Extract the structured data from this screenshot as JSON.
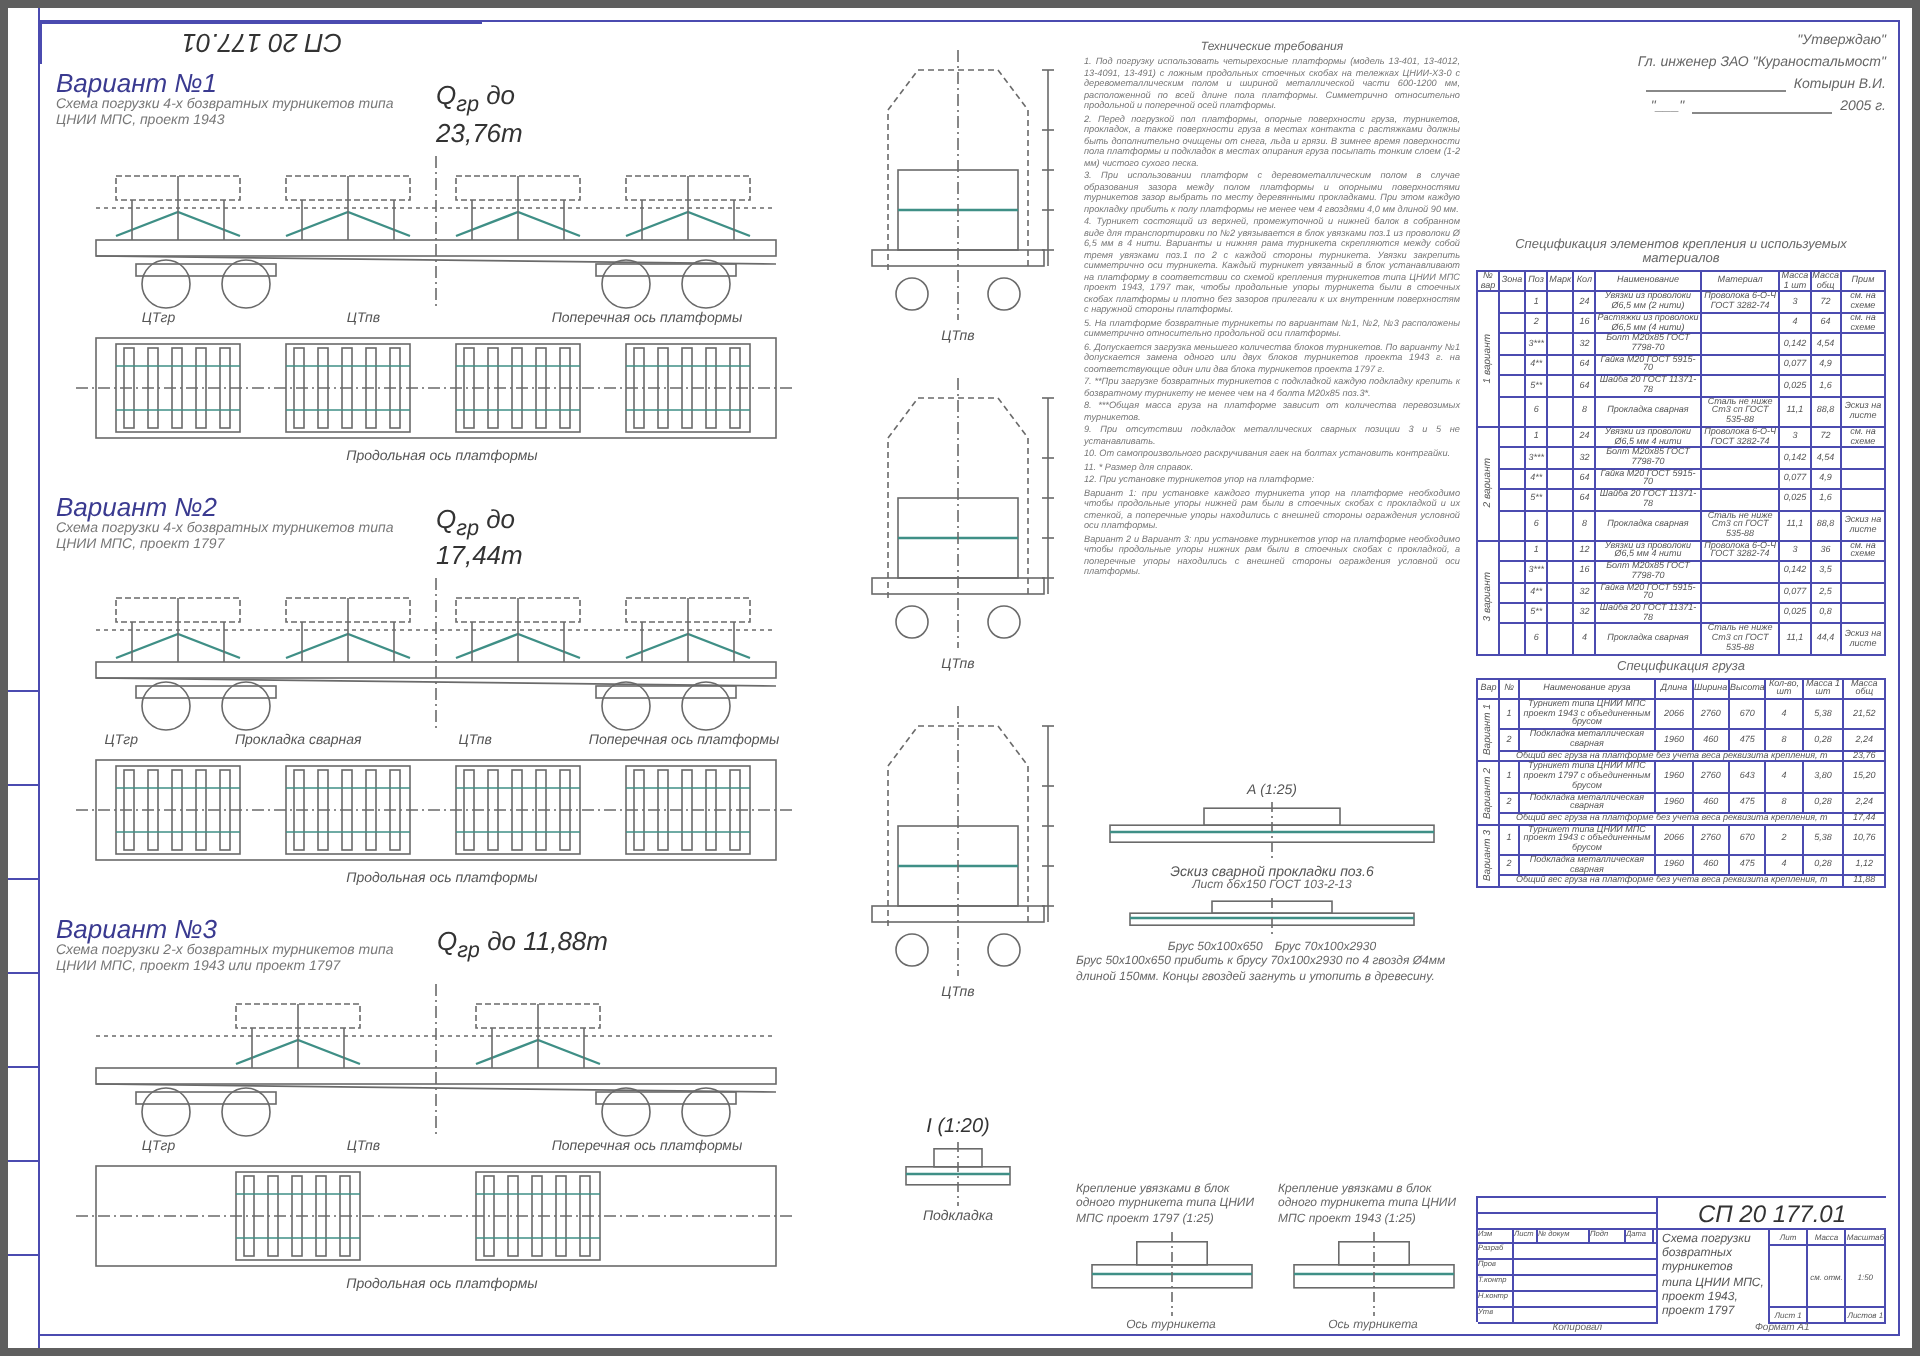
{
  "stamp": "СП 20 177.01",
  "variants": [
    {
      "kind": "four_units",
      "title": "Вариант №1",
      "subtitle": "Схема погрузки 4-х бозвратных турникетов типа ЦНИИ МПС, проект 1943",
      "load": "Q$_{гр}$ до 23,76т",
      "side_labels": [
        "ЦТгр",
        "ЦТпв",
        "Поперечная ось платформы"
      ],
      "top_label": "Продольная ось платформы"
    },
    {
      "kind": "four_units",
      "title": "Вариант №2",
      "subtitle": "Схема погрузки 4-х бозвратных турникетов типа ЦНИИ МПС, проект 1797",
      "load": "Q$_{гр}$ до 17,44т",
      "side_labels": [
        "ЦТгр",
        "Прокладка сварная",
        "ЦТпв",
        "Поперечная ось платформы"
      ],
      "top_label": "Продольная ось платформы"
    },
    {
      "kind": "two_units",
      "title": "Вариант №3",
      "subtitle": "Схема погрузки 2-х бозвратных турникетов типа ЦНИИ МПС, проект 1943 или проект 1797",
      "load": "Q$_{гр}$ до 11,88т",
      "side_labels": [
        "ЦТгр",
        "ЦТпв",
        "Поперечная ось платформы"
      ],
      "top_label": "Продольная ось платформы"
    }
  ],
  "sections": [
    {
      "label": "ЦТпв"
    },
    {
      "label": "ЦТпв"
    },
    {
      "label": "ЦТпв"
    }
  ],
  "detail_i": {
    "title": "I (1:20)",
    "label": "Подкладка"
  },
  "notes": {
    "title": "Технические требования",
    "items": [
      "1. Под погрузку использовать четырехосные платформы (модель 13-401, 13-4012, 13-4091, 13-491) с ложным продольных стоечных скобах на тележках ЦНИИ-Х3-0 с деревометаллическим полом и шириной металлической части 600-1200 мм, расположенной по всей длине пола платформы. Симметрично относительно продольной и поперечной осей платформы.",
      "2. Перед погрузкой пол платформы, опорные поверхности груза, турникетов, прокладок, а также поверхности груза в местах контакта с растяжками должны быть дополнительно очищены от снега, льда и грязи. В зимнее время поверхности пола платформы и подкладок в местах опирания груза посыпать тонким слоем (1-2 мм) чистого сухого песка.",
      "3. При использовании платформ с деревометаллическим полом в случае образования зазора между полом платформы и опорными поверхностями турникетов зазор выбрать по месту деревянными прокладками. При этом каждую прокладку прибить к полу платформы не менее чем 4 гвоздями 4,0 мм длиной 90 мм.",
      "4. Турникет состоящий из верхней, промежуточной и нижней балок в собранном виде для транспортировки по №2 увязывается в блок увязками поз.1 из проволоки Ø 6,5 мм в 4 нити. Варианты и нижняя рама турникета скрепляются между собой тремя увязками поз.1 по 2 с каждой стороны турникета. Увязки закрепить симметрично оси турникета. Каждый турникет увязанный в блок устанавливают на платформу в соответствии со схемой крепления турникетов типа ЦНИИ МПС проект 1943, 1797 так, чтобы продольные упоры турникета были в стоечных скобах платформы и плотно без зазоров прилегали к их внутренним поверхностям с наружной стороны платформы.",
      "5. На платформе бозвратные турникеты по вариантам №1, №2, №3 расположены симметрично относительно продольной оси платформы.",
      "6. Допускается загрузка меньшего количества блоков турникетов. По варианту №1 допускается замена одного или двух блоков турникетов проекта 1943 г. на соответствующие один или два блока турникетов проекта 1797 г.",
      "7. **При загрузке бозвратных турникетов с подкладкой каждую подкладку крепить к бозвратному турникету не менее чем на 4 болта М20х85 поз.3*.",
      "8. ***Общая масса груза на платформе зависит от количества перевозимых турникетов.",
      "9. При отсутствии подкладок металлических сварных позиции 3 и 5 не устанавливать.",
      "10. От самопроизвольного раскручивания гаек на болтах установить контргайки.",
      "11. * Размер для справок.",
      "12. При установке турникетов упор на платформе:",
      "Вариант 1: при установке каждого турникета упор на платформе необходимо чтобы продольные упоры нижней рам были в стоечных скобах с прокладкой и их стенкой, а поперечные упоры находились с внешней стороны ограждения условной оси платформы.",
      "Вариант 2 и Вариант 3: при установке турникетов упор на платформе необходимо чтобы продольные упоры нижних рам были в стоечных скобах с прокладкой, а поперечные упоры находились с внешней стороны ограждения условной оси платформы."
    ]
  },
  "approval": {
    "head": "\"Утверждаю\"",
    "position": "Гл. инженер ЗАО \"Кураностальмост\"",
    "name": "Котырин В.И.",
    "date_mark": "\"___\"",
    "year": "2005 г."
  },
  "section_a": {
    "title": "А (1:25)"
  },
  "weld_pad": {
    "title": "Эскиз сварной прокладки поз.6",
    "spec": "Лист δ6х150 ГОСТ 103-2-13",
    "bar_small": "Брус 50х100х650",
    "bar_large": "Брус 70х100х2930",
    "note": "Брус 50х100х650 прибить к брусу 70х100х2930 по 4 гвоздя Ø4мм длиной 150мм. Концы гвоздей загнуть и утопить в древесину."
  },
  "fastening": [
    {
      "title": "Крепление увязками в блок одного турникета типа ЦНИИ МПС проект 1797 (1:25)",
      "label": "Ось турникета"
    },
    {
      "title": "Крепление увязками в блок одного турникета типа ЦНИИ МПС проект 1943 (1:25)",
      "label": "Ось турникета"
    }
  ],
  "spec_table": {
    "title": "Спецификация элементов крепления и используемых материалов",
    "columns": [
      "№ вар",
      "Зона",
      "Поз",
      "Марк",
      "Кол",
      "Наименование",
      "Материал",
      "Масса 1 шт",
      "Масса общ",
      "Прим"
    ],
    "groups": [
      {
        "variant": "1 вариант",
        "rows": [
          [
            "",
            "1",
            "",
            "24",
            "Увязки из проволоки Ø6,5 мм (2 нити)",
            "Проволока 6-О-Ч ГОСТ 3282-74",
            "3",
            "72",
            "см. на схеме"
          ],
          [
            "",
            "2",
            "",
            "16",
            "Растяжки из проволоки Ø6,5 мм (4 нити)",
            "",
            "4",
            "64",
            "см. на схеме"
          ],
          [
            "",
            "3***",
            "",
            "32",
            "Болт М20х85 ГОСТ 7798-70",
            "",
            "0,142",
            "4,54",
            ""
          ],
          [
            "",
            "4**",
            "",
            "64",
            "Гайка М20 ГОСТ 5915-70",
            "",
            "0,077",
            "4,9",
            ""
          ],
          [
            "",
            "5**",
            "",
            "64",
            "Шайба 20 ГОСТ 11371-78",
            "",
            "0,025",
            "1,6",
            ""
          ],
          [
            "",
            "6",
            "",
            "8",
            "Прокладка сварная",
            "Сталь не ниже Ст3 сп ГОСТ 535-88",
            "11,1",
            "88,8",
            "Эскиз на листе"
          ]
        ]
      },
      {
        "variant": "2 вариант",
        "rows": [
          [
            "",
            "1",
            "",
            "24",
            "Увязки из проволоки Ø6,5 мм 4 нити",
            "Проволока 6-О-Ч ГОСТ 3282-74",
            "3",
            "72",
            "см. на схеме"
          ],
          [
            "",
            "3***",
            "",
            "32",
            "Болт М20х85 ГОСТ 7798-70",
            "",
            "0,142",
            "4,54",
            ""
          ],
          [
            "",
            "4**",
            "",
            "64",
            "Гайка М20 ГОСТ 5915-70",
            "",
            "0,077",
            "4,9",
            ""
          ],
          [
            "",
            "5**",
            "",
            "64",
            "Шайба 20 ГОСТ 11371-78",
            "",
            "0,025",
            "1,6",
            ""
          ],
          [
            "",
            "6",
            "",
            "8",
            "Прокладка сварная",
            "Сталь не ниже Ст3 сп ГОСТ 535-88",
            "11,1",
            "88,8",
            "Эскиз на листе"
          ]
        ]
      },
      {
        "variant": "3 вариант",
        "rows": [
          [
            "",
            "1",
            "",
            "12",
            "Увязки из проволоки Ø6,5 мм 4 нити",
            "Проволока 6-О-Ч ГОСТ 3282-74",
            "3",
            "36",
            "см. на схеме"
          ],
          [
            "",
            "3***",
            "",
            "16",
            "Болт М20х85 ГОСТ 7798-70",
            "",
            "0,142",
            "3,5",
            ""
          ],
          [
            "",
            "4**",
            "",
            "32",
            "Гайка М20 ГОСТ 5915-70",
            "",
            "0,077",
            "2,5",
            ""
          ],
          [
            "",
            "5**",
            "",
            "32",
            "Шайба 20 ГОСТ 11371-78",
            "",
            "0,025",
            "0,8",
            ""
          ],
          [
            "",
            "6",
            "",
            "4",
            "Прокладка сварная",
            "Сталь не ниже Ст3 сп ГОСТ 535-88",
            "11,1",
            "44,4",
            "Эскиз на листе"
          ]
        ]
      }
    ]
  },
  "cargo_table": {
    "title": "Спецификация груза",
    "columns": [
      "Вар",
      "№",
      "Наименование груза",
      "Длина",
      "Ширина",
      "Высота",
      "Кол-во, шт",
      "Масса 1 шт",
      "Масса общ"
    ],
    "groups": [
      {
        "variant": "Вариант 1",
        "rows": [
          [
            "1",
            "Турникет типа ЦНИИ МПС проект 1943 с объединенным брусом",
            "2066",
            "2760",
            "670",
            "4",
            "5,38",
            "21,52"
          ],
          [
            "2",
            "Подкладка металлическая сварная",
            "1960",
            "460",
            "475",
            "8",
            "0,28",
            "2,24"
          ]
        ],
        "total_label": "Общий вес груза на платформе без учета веса реквизита крепления, т",
        "total": "23,76"
      },
      {
        "variant": "Вариант 2",
        "rows": [
          [
            "1",
            "Турникет типа ЦНИИ МПС проект 1797 с объединенным брусом",
            "1960",
            "2760",
            "643",
            "4",
            "3,80",
            "15,20"
          ],
          [
            "2",
            "Подкладка металлическая сварная",
            "1960",
            "460",
            "475",
            "8",
            "0,28",
            "2,24"
          ]
        ],
        "total_label": "Общий вес груза на платформе без учета веса реквизита крепления, т",
        "total": "17,44"
      },
      {
        "variant": "Вариант 3",
        "rows": [
          [
            "1",
            "Турникет типа ЦНИИ МПС проект 1943 с объединенным брусом",
            "2066",
            "2760",
            "670",
            "2",
            "5,38",
            "10,76"
          ],
          [
            "2",
            "Подкладка металлическая сварная",
            "1960",
            "460",
            "475",
            "4",
            "0,28",
            "1,12"
          ]
        ],
        "total_label": "Общий вес груза на платформе без учета веса реквизита крепления, т",
        "total": "11,88"
      }
    ]
  },
  "title_block": {
    "code": "СП 20 177.01",
    "name": "Схема погрузки бозвратных турникетов типа ЦНИИ МПС, проект 1943, проект 1797",
    "cols": [
      "Изм",
      "Лист",
      "№ докум",
      "Подп",
      "Дата"
    ],
    "roles": [
      "Разраб",
      "Пров",
      "Т.контр",
      "Н.контр",
      "Утв"
    ],
    "lit": "Лит",
    "mass": "Масса",
    "scale": "Масштаб",
    "mass_value": "см. отм.",
    "scale_value": "1:50",
    "sheet": "Лист 1",
    "sheets": "Листов 1"
  },
  "footer": {
    "copied": "Копировал",
    "format": "Формат А1"
  }
}
